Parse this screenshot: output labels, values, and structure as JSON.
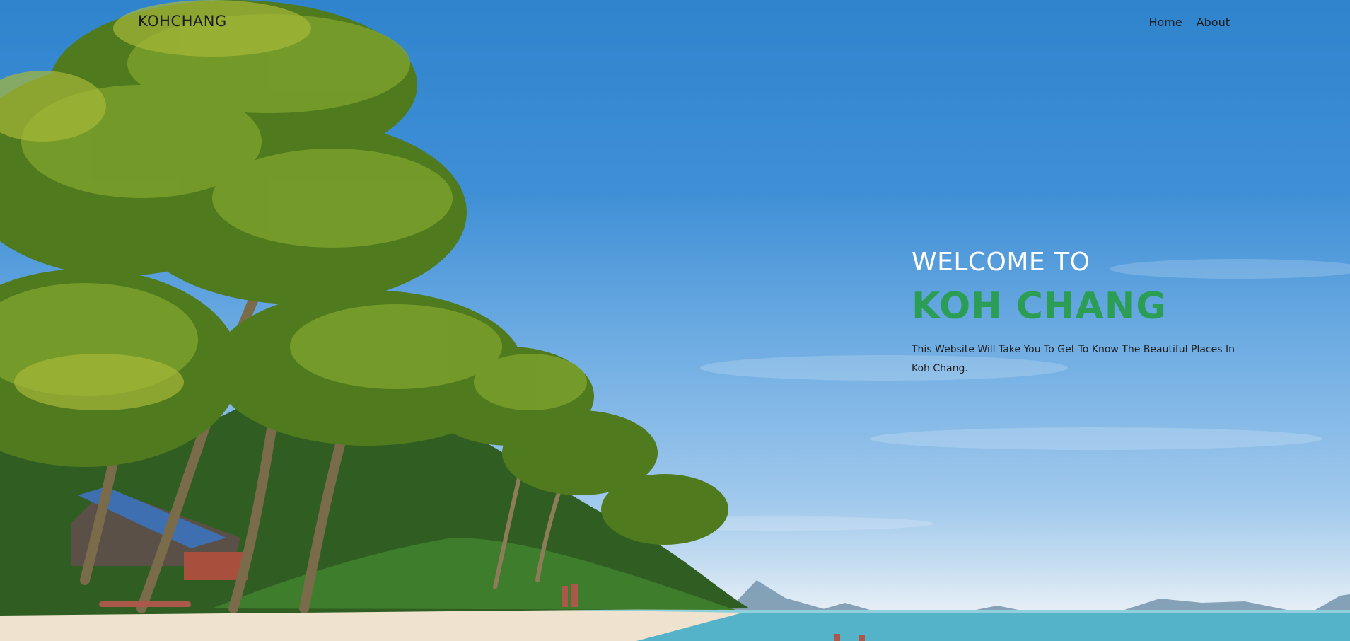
{
  "brand": {
    "logo_text": "KOHCHANG"
  },
  "nav": {
    "items": [
      {
        "label": "Home"
      },
      {
        "label": "About"
      }
    ]
  },
  "hero": {
    "welcome": "WELCOME TO",
    "title": "KOH CHANG",
    "description": "This Website Will Take You To Get To Know The Beautiful Places In Koh Chang."
  },
  "colors": {
    "title_accent": "#2b9d55",
    "sky": "#3f8fd6",
    "sea": "#55b3c9",
    "sand": "#efe3cf"
  },
  "background": {
    "subject": "tropical beach with palm trees and sea"
  }
}
